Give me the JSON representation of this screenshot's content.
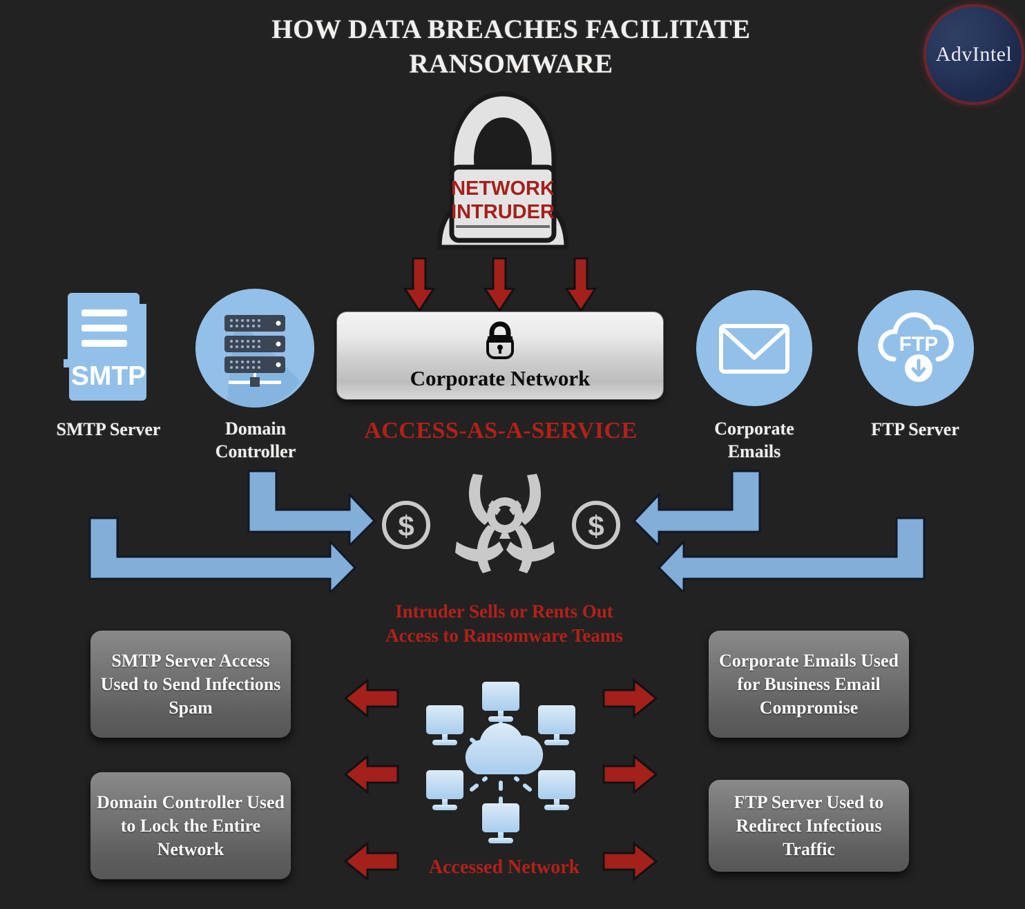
{
  "page": {
    "title_line1": "HOW DATA BREACHES FACILITATE",
    "title_line2": "RANSOMWARE",
    "background_color": "#222222"
  },
  "logo": {
    "name": "AdvIntel",
    "ring_color": "#7a2328",
    "fill_color": "#26355a"
  },
  "intruder": {
    "label_line1": "NETWORK",
    "label_line2": "INTRUDER",
    "label_color": "#a4201b",
    "icon": "hooded-hacker-with-laptop"
  },
  "corporate_network": {
    "label": "Corporate Network",
    "icon": "padlock-icon",
    "tagline": "ACCESS-AS-A-SERVICE",
    "tagline_color": "#b3201a"
  },
  "assets": [
    {
      "id": "smtp",
      "label": "SMTP Server",
      "icon": "smtp-file-icon",
      "badge": "SMTP"
    },
    {
      "id": "dc",
      "label": "Domain\nController",
      "icon": "server-rack-icon",
      "badge": ""
    },
    {
      "id": "mail",
      "label": "Corporate\nEmails",
      "icon": "envelope-icon",
      "badge": ""
    },
    {
      "id": "ftp",
      "label": "FTP Server",
      "icon": "ftp-cloud-download-icon",
      "badge": "FTP"
    }
  ],
  "asset_labels": {
    "smtp": "SMTP Server",
    "dc_line1": "Domain",
    "dc_line2": "Controller",
    "mail_line1": "Corporate",
    "mail_line2": "Emails",
    "ftp": "FTP Server"
  },
  "marketplace": {
    "icon": "biohazard-icon",
    "coin_icon": "dollar-coin-icon",
    "caption_line1": "Intruder Sells or Rents Out",
    "caption_line2": "Access to Ransomware Teams",
    "caption_color": "#b3201a"
  },
  "outcomes": [
    {
      "id": "smtp-outcome",
      "text": "SMTP Server Access Used to Send Infections Spam"
    },
    {
      "id": "dc-outcome",
      "text": "Domain Controller Used to Lock the Entire Network"
    },
    {
      "id": "mail-outcome",
      "text": "Corporate Emails Used for Business Email Compromise"
    },
    {
      "id": "ftp-outcome",
      "text": "FTP Server Used to Redirect Infectious Traffic"
    }
  ],
  "accessed_network": {
    "label": "Accessed Network",
    "icon": "cloud-network-icon",
    "label_color": "#b3201a"
  },
  "colors": {
    "background": "#222222",
    "accent_blue": "#82aed8",
    "accent_red": "#a4201b",
    "icon_blue": "#93c0e8",
    "text_light": "#f2f0ee",
    "box_gray": "#6d6d6d"
  }
}
